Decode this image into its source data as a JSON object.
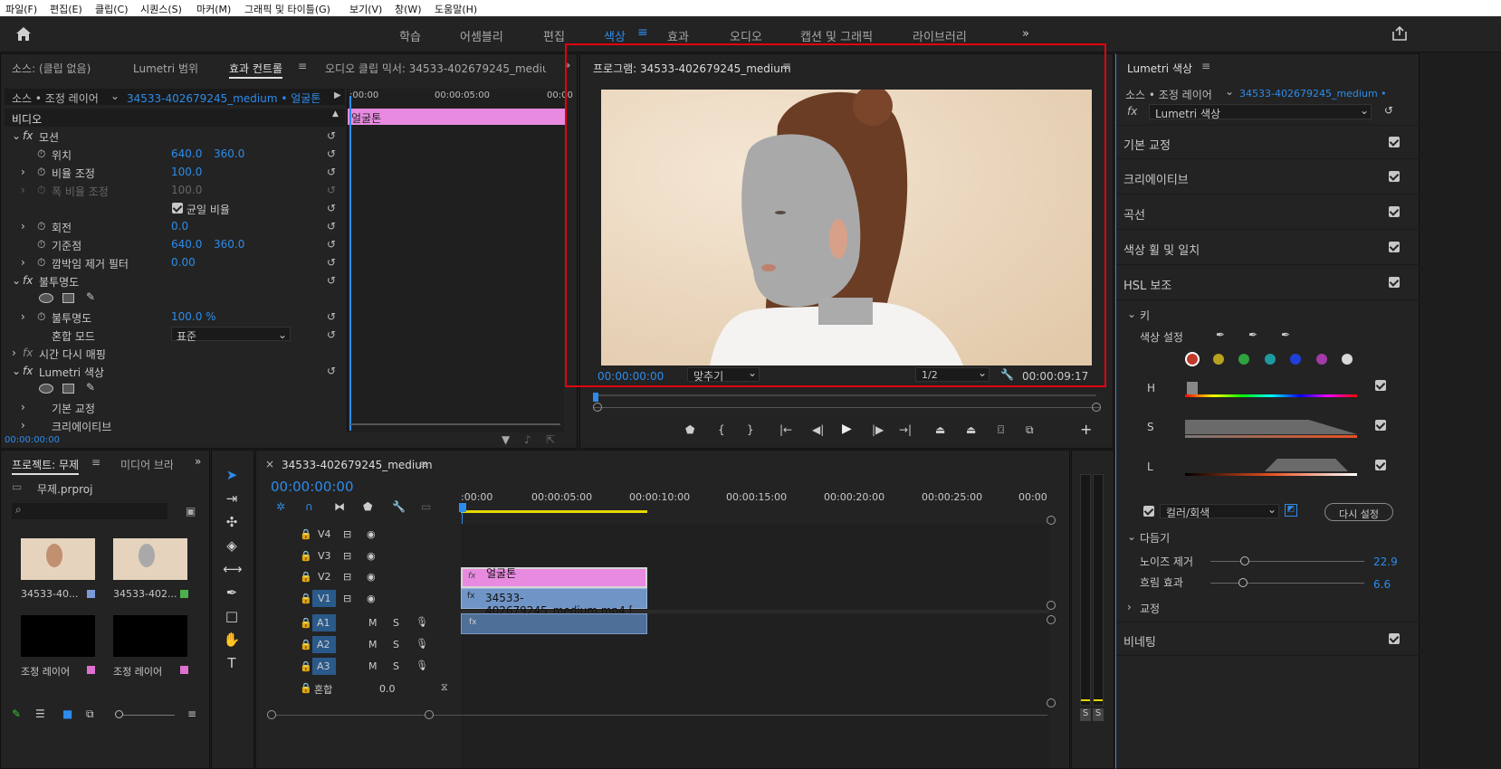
{
  "menu": [
    "파일(F)",
    "편집(E)",
    "클립(C)",
    "시퀀스(S)",
    "마커(M)",
    "그래픽 및 타이틀(G)",
    "보기(V)",
    "창(W)",
    "도움말(H)"
  ],
  "workspaces": [
    "학습",
    "어셈블리",
    "편집",
    "색상",
    "효과",
    "오디오",
    "캡션 및 그래픽",
    "라이브러리"
  ],
  "active_workspace": "색상",
  "source_panel": {
    "tabs": [
      "소스: (클립 없음)",
      "Lumetri 범위",
      "효과 컨트롤",
      "오디오 클립 믹서: 34533-402679245_mediun"
    ],
    "source_label": "소스 • 조정 레이어",
    "clip_label": "34533-402679245_medium • 얼굴톤",
    "timeline_ticks": [
      ":00:00",
      "00:00:05:00",
      "00:00"
    ],
    "clip_bar": "얼굴톤",
    "video_header": "비디오",
    "motion": "모션",
    "position": "위치",
    "pos_x": "640.0",
    "pos_y": "360.0",
    "scale": "비율 조정",
    "scale_val": "100.0",
    "scale_w": "폭 비율 조정",
    "scale_w_val": "100.0",
    "uniform": "균일 비율",
    "rotation": "회전",
    "rotation_val": "0.0",
    "anchor": "기준점",
    "anchor_x": "640.0",
    "anchor_y": "360.0",
    "flicker": "깜박임 제거 필터",
    "flicker_val": "0.00",
    "opacity_fx": "불투명도",
    "opacity": "불투명도",
    "opacity_val": "100.0 %",
    "blend": "혼합 모드",
    "blend_val": "표준",
    "time_remap": "시간 다시 매핑",
    "lumetri": "Lumetri 색상",
    "basic": "기본 교정",
    "creative": "크리에이티브",
    "timecode": "00:00:00:00"
  },
  "program": {
    "title": "프로그램: 34533-402679245_medium",
    "timecode": "00:00:00:00",
    "fit": "맞추기",
    "resolution": "1/2",
    "duration": "00:00:09:17"
  },
  "lumetri": {
    "title": "Lumetri 색상",
    "source": "소스 • 조정 레이어",
    "clip": "34533-402679245_medium •",
    "effect": "Lumetri 색상",
    "sections": [
      "기본 교정",
      "크리에이티브",
      "곡선",
      "색상 휠 및 일치",
      "HSL 보조"
    ],
    "key": "키",
    "color_set": "색상 설정",
    "h": "H",
    "s": "S",
    "l": "L",
    "color_gray": "컬러/회색",
    "reset": "다시 설정",
    "refine": "다듬기",
    "denoise": "노이즈 제거",
    "denoise_val": "22.9",
    "blur": "흐림 효과",
    "blur_val": "6.6",
    "correction": "교정",
    "vignette": "비네팅",
    "swatch_colors": [
      "#c0392b",
      "#b7a21e",
      "#2fa33f",
      "#1d9aa0",
      "#2040d8",
      "#a23aa8",
      "#d8d8d8"
    ]
  },
  "project": {
    "tabs": [
      "프로젝트: 무제",
      "미디어 브라"
    ],
    "file": "무제.prproj",
    "items": [
      "34533-40...",
      "34533-402...",
      "조정 레이어",
      "조정 레이어"
    ]
  },
  "timeline": {
    "title": "34533-402679245_medium",
    "timecode": "00:00:00:00",
    "ruler": [
      ":00:00",
      "00:00:05:00",
      "00:00:10:00",
      "00:00:15:00",
      "00:00:20:00",
      "00:00:25:00",
      "00:00"
    ],
    "tracks": [
      "V4",
      "V3",
      "V2",
      "V1",
      "A1",
      "A2",
      "A3"
    ],
    "mix": "혼합",
    "mix_val": "0.0",
    "clip_v2": "얼굴톤",
    "clip_v1": "34533-402679245_medium.mp4 [",
    "meter_labels": [
      "S",
      "S"
    ]
  }
}
